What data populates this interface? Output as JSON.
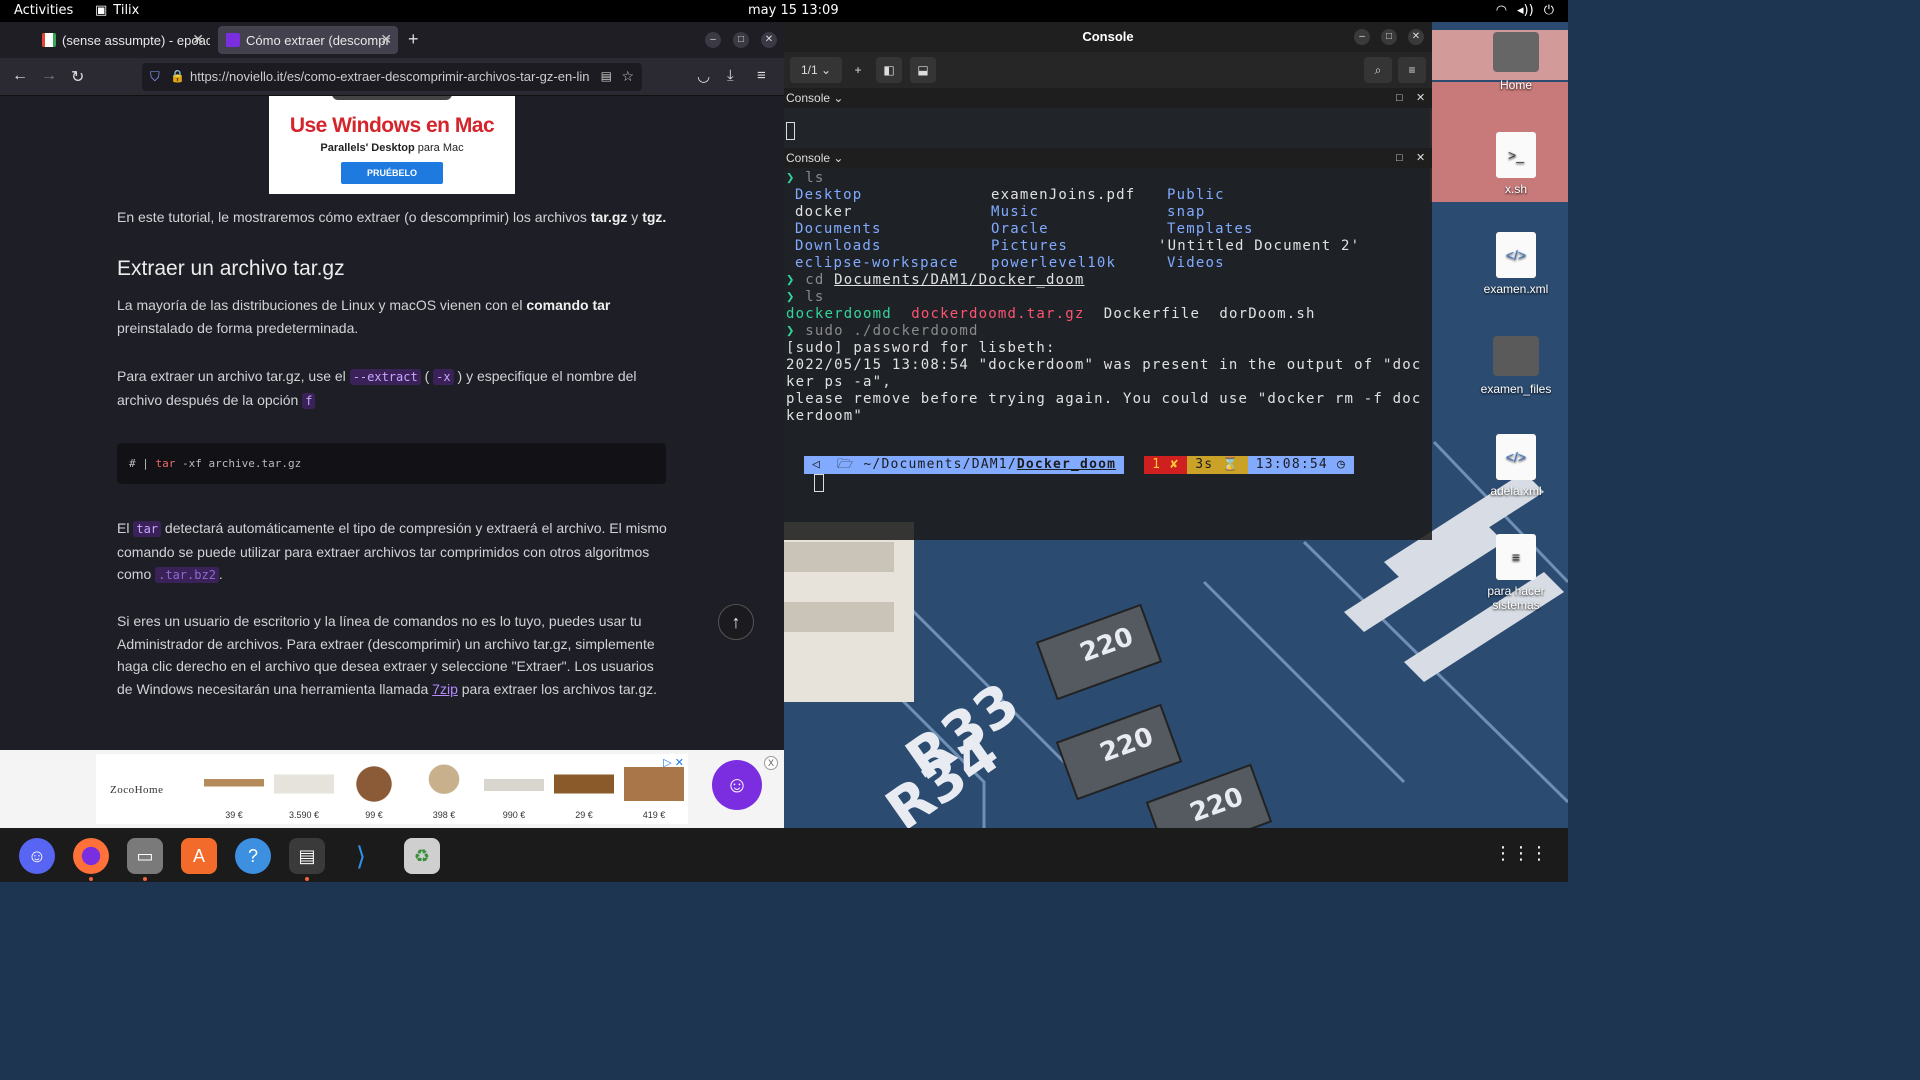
{
  "topbar": {
    "activities": "Activities",
    "app_name": "Tilix",
    "clock": "may 15  13:09"
  },
  "firefox": {
    "tab1_title": "(sense assumpte) - epoac",
    "tab2_title": "Cómo extraer (descompr",
    "url": "https://noviello.it/es/como-extraer-descomprimir-archivos-tar-gz-en-lin"
  },
  "page": {
    "ad_top": {
      "headline": "Use Windows en Mac",
      "brand_bold": "Parallels' Desktop",
      "brand_rest": " para Mac",
      "button": "PRUÉBELO"
    },
    "intro_text": "En este tutorial, le mostraremos cómo extraer (o descomprimir) los archivos ",
    "intro_b1": "tar.gz",
    "intro_y": " y ",
    "intro_b2": "tgz.",
    "heading": "Extraer un archivo tar.gz",
    "p1_a": "La mayoría de las distribuciones de Linux y macOS vienen con el ",
    "p1_b": "comando tar",
    "p1_c": " preinstalado de forma predeterminada.",
    "p2_a": "Para extraer un archivo tar.gz, use el ",
    "p2_code1": "--extract",
    "p2_paren_open": " ( ",
    "p2_code2": "-x",
    "p2_b": " ) y especifique el nombre del archivo después de la opción ",
    "p2_code3": "f",
    "code_prefix": "# | ",
    "code_kw": "tar",
    "code_rest": " -xf archive.tar.gz",
    "p3_a": "El ",
    "p3_code": "tar",
    "p3_b": " detectará automáticamente el tipo de compresión y extraerá el archivo. El mismo comando se puede utilizar para extraer archivos tar comprimidos con otros algoritmos como ",
    "p3_code2": ".tar.bz2",
    "p3_c": ".",
    "p4_a": "Si eres un usuario de escritorio y la línea de comandos no es lo tuyo, puedes usar tu Administrador de archivos. Para extraer (descomprimir) un archivo tar.gz, simplemente haga clic derecho en el archivo que desea extraer y seleccione \"Extraer\". Los usuarios de Windows necesitarán una herramienta llamada ",
    "p4_link": "7zip",
    "p4_b": " para extraer los archivos tar.gz.",
    "ad_bottom": {
      "logo": "ZocoHome",
      "prices": [
        "39 €",
        "3.590 €",
        "99 €",
        "398 €",
        "990 €",
        "29 €",
        "419 €"
      ],
      "close": "X"
    }
  },
  "tilix": {
    "title": "Console",
    "tab_counter": "1/1",
    "pane_label_1": "Console",
    "pane_label_2": "Console",
    "ls1": "ls",
    "ls_col1": [
      "Desktop",
      "docker",
      "Documents",
      "Downloads",
      "eclipse-workspace"
    ],
    "ls_col2": [
      "examenJoins.pdf",
      "Music",
      "Oracle",
      "Pictures",
      "powerlevel10k"
    ],
    "ls_col3": [
      "Public",
      "snap",
      "Templates",
      "'Untitled Document 2'",
      "Videos"
    ],
    "cd_cmd": "cd",
    "cd_path": "Documents/DAM1/Docker_doom",
    "ls2": "ls",
    "ls2_items": [
      "dockerdoomd",
      "dockerdoomd.tar.gz",
      "Dockerfile",
      "dorDoom.sh"
    ],
    "sudo_cmd": "sudo ./dockerdoomd",
    "out1": "[sudo] password for lisbeth:",
    "out2": "2022/05/15 13:08:54 \"dockerdoom\" was present in the output of \"doc",
    "out3": "ker ps -a\",",
    "out4": "please remove before trying again. You could use \"docker rm -f doc",
    "out5": "kerdoom\"",
    "pl_path_prefix": "~/Documents/DAM1/",
    "pl_path_last": "Docker_doom",
    "pl_status": "1 ✘",
    "pl_duration": "3s ⌛",
    "pl_time": "13:08:54 ◷"
  },
  "desktop": {
    "icons": [
      "Home",
      "x.sh",
      "examen.xml",
      "examen_files",
      "adela.xml",
      "para hacer sistemas"
    ]
  },
  "colors": {
    "accent_purple": "#7b2ee0",
    "prompt_green": "#34d399",
    "ls_blue": "#82aaff",
    "error_red": "#ff5370"
  }
}
